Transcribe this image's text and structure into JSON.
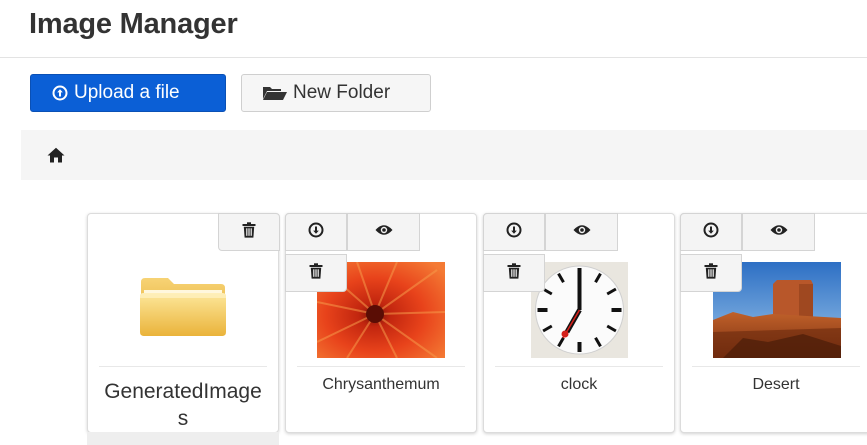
{
  "page": {
    "title": "Image Manager"
  },
  "toolbar": {
    "upload_label": "Upload a file",
    "new_folder_label": "New Folder",
    "upload_icon": "circle-up-icon",
    "folder_icon": "folder-open-icon"
  },
  "breadcrumb": {
    "home_icon": "home-icon"
  },
  "items": [
    {
      "name": "GeneratedImages",
      "name_lines": [
        "GeneratedImage",
        "s"
      ],
      "kind": "folder"
    },
    {
      "name": "Chrysanthemum",
      "kind": "image"
    },
    {
      "name": "clock",
      "kind": "image"
    },
    {
      "name": "Desert",
      "kind": "image"
    }
  ],
  "colors": {
    "primary": "#0b5fd6",
    "folder": "#f3c14b"
  }
}
